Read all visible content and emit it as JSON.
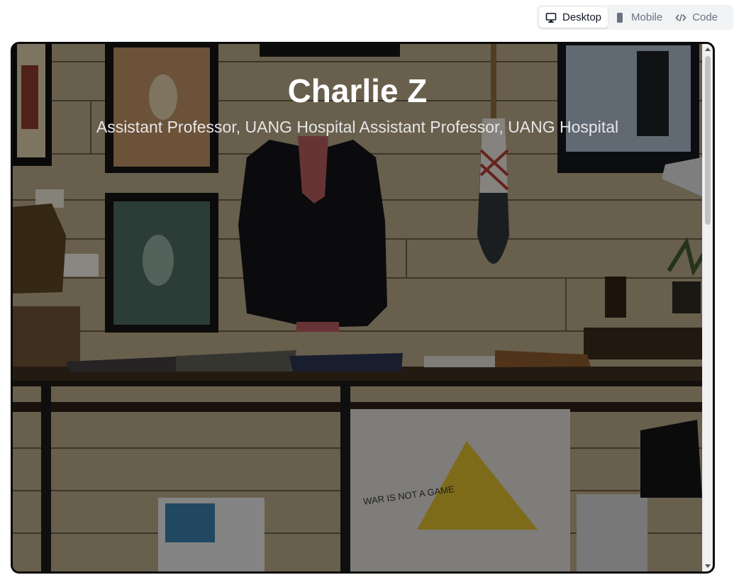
{
  "view_tabs": [
    {
      "label": "Desktop",
      "icon": "monitor-icon",
      "active": true
    },
    {
      "label": "Mobile",
      "icon": "phone-icon",
      "active": false
    },
    {
      "label": "Code",
      "icon": "code-icon",
      "active": false
    }
  ],
  "hero": {
    "title": "Charlie Z",
    "subtitle": "Assistant Professor, UANG Hospital Assistant Professor, UANG Hospital",
    "poster_text": "WAR IS NOT A GAME"
  },
  "colors": {
    "overlay": "#000000",
    "wall": "#b9a98a",
    "title": "#ffffff"
  }
}
